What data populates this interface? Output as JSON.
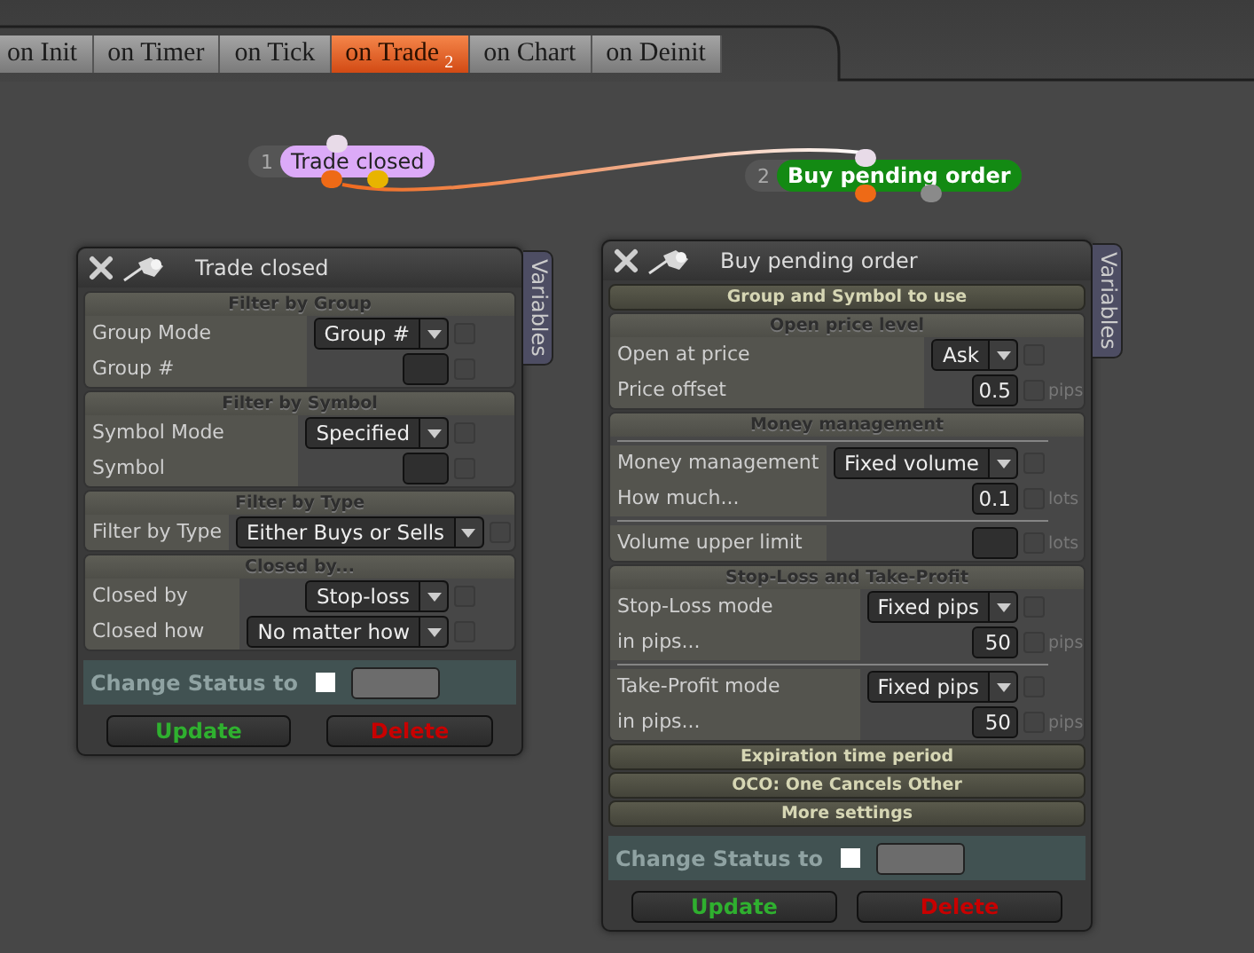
{
  "tabs": [
    {
      "label": "on Init",
      "selected": false
    },
    {
      "label": "on Timer",
      "selected": false
    },
    {
      "label": "on Tick",
      "selected": false
    },
    {
      "label": "on Trade",
      "badge": "2",
      "selected": true
    },
    {
      "label": "on Chart",
      "selected": false
    },
    {
      "label": "on Deinit",
      "selected": false
    }
  ],
  "nodes": [
    {
      "number": "1",
      "label": "Trade closed",
      "color": "#dcaaf8"
    },
    {
      "number": "2",
      "label": "Buy pending order",
      "color": "#138a13"
    }
  ],
  "panels": [
    {
      "title": "Trade closed",
      "side_tab": "Variables",
      "sections": [
        {
          "kind": "group",
          "title": "Filter by Group",
          "rows": [
            {
              "kind": "select",
              "label": "Group Mode",
              "value": "Group #",
              "checked": false
            },
            {
              "kind": "input",
              "label": "Group #",
              "checked": false
            }
          ]
        },
        {
          "kind": "group",
          "title": "Filter by Symbol",
          "rows": [
            {
              "kind": "select",
              "label": "Symbol Mode",
              "value": "Specified",
              "checked": false
            },
            {
              "kind": "input",
              "label": "Symbol",
              "checked": false
            }
          ]
        },
        {
          "kind": "group",
          "title": "Filter by Type",
          "rows": [
            {
              "kind": "select",
              "label": "Filter by Type",
              "value": "Either Buys or Sells",
              "checked": false
            }
          ]
        },
        {
          "kind": "group",
          "title": "Closed by...",
          "rows": [
            {
              "kind": "select",
              "label": "Closed by",
              "value": "Stop-loss",
              "checked": false
            },
            {
              "kind": "select",
              "label": "Closed how",
              "value": "No matter how",
              "checked": false
            }
          ]
        }
      ],
      "status": {
        "label": "Change Status to"
      },
      "buttons": [
        {
          "kind": "update",
          "label": "Update"
        },
        {
          "kind": "delete",
          "label": "Delete"
        }
      ]
    },
    {
      "title": "Buy pending order",
      "side_tab": "Variables",
      "sections": [
        {
          "kind": "collapsed",
          "title": "Group and Symbol to use"
        },
        {
          "kind": "group",
          "title": "Open price level",
          "rows": [
            {
              "kind": "select",
              "label": "Open at price",
              "value": "Ask",
              "checked": false
            },
            {
              "kind": "input",
              "label": "Price offset",
              "value": "0.5",
              "unit": "pips",
              "checked": false
            }
          ]
        },
        {
          "kind": "group",
          "title": "Money management",
          "rows": [
            {
              "kind": "divider"
            },
            {
              "kind": "select",
              "label": "Money management",
              "value": "Fixed volume",
              "checked": false
            },
            {
              "kind": "input",
              "label": "How much...",
              "value": "0.1",
              "unit": "lots",
              "checked": false
            },
            {
              "kind": "divider"
            },
            {
              "kind": "input",
              "label": "Volume upper limit",
              "unit": "lots",
              "checked": false
            }
          ]
        },
        {
          "kind": "group",
          "title": "Stop-Loss and Take-Profit",
          "rows": [
            {
              "kind": "select",
              "label": "Stop-Loss mode",
              "value": "Fixed pips",
              "checked": false
            },
            {
              "kind": "input",
              "label": "in pips...",
              "value": "50",
              "unit": "pips",
              "checked": false
            },
            {
              "kind": "divider"
            },
            {
              "kind": "select",
              "label": "Take-Profit mode",
              "value": "Fixed pips",
              "checked": false
            },
            {
              "kind": "input",
              "label": "in pips...",
              "value": "50",
              "unit": "pips",
              "checked": false
            }
          ]
        },
        {
          "kind": "collapsed",
          "title": "Expiration time period"
        },
        {
          "kind": "collapsed",
          "title": "OCO: One Cancels Other"
        },
        {
          "kind": "collapsed",
          "title": "More settings"
        }
      ],
      "status": {
        "label": "Change Status to"
      },
      "buttons": [
        {
          "kind": "update",
          "label": "Update"
        },
        {
          "kind": "delete",
          "label": "Delete"
        }
      ]
    }
  ]
}
